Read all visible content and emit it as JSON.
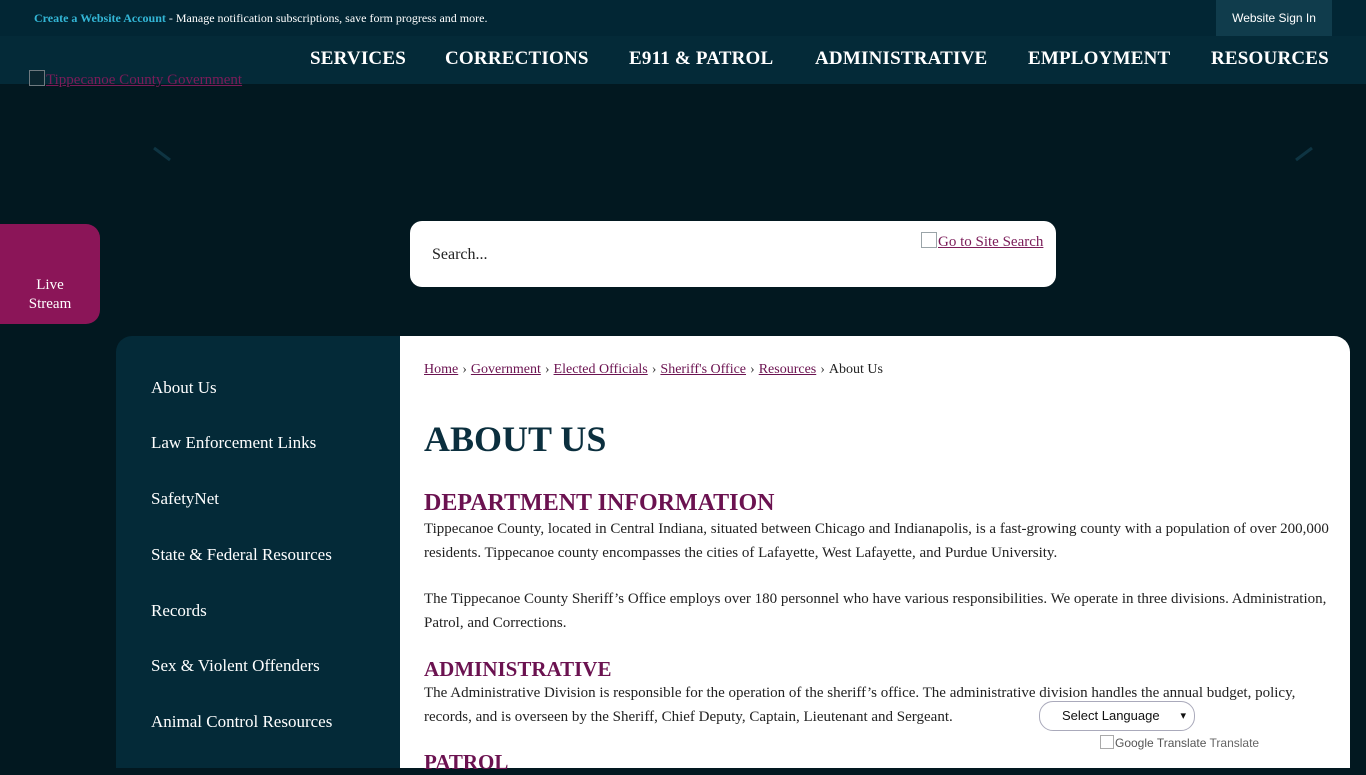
{
  "topbar": {
    "account_link": "Create a Website Account",
    "account_note": " - Manage notification subscriptions, save form progress and more.",
    "sign_in": "Website Sign In"
  },
  "nav": {
    "items": [
      "SERVICES",
      "CORRECTIONS",
      "E911 & PATROL",
      "ADMINISTRATIVE",
      "EMPLOYMENT",
      "RESOURCES"
    ]
  },
  "logo": {
    "alt": "Tippecanoe County Government"
  },
  "live_stream": {
    "label_line1": "Live",
    "label_line2": "Stream"
  },
  "search": {
    "placeholder": "Search...",
    "button_alt": "Go to Site Search"
  },
  "sidebar": {
    "items": [
      "About Us",
      "Law Enforcement Links",
      "SafetyNet",
      "State & Federal Resources",
      "Records",
      "Sex & Violent Offenders",
      "Animal Control Resources"
    ]
  },
  "breadcrumb": {
    "links": [
      "Home",
      "Government",
      "Elected Officials",
      "Sheriff's Office",
      "Resources"
    ],
    "current": "About Us"
  },
  "page": {
    "title": "ABOUT US",
    "sections": [
      {
        "heading": "DEPARTMENT INFORMATION",
        "paragraphs": [
          "Tippecanoe County, located in Central Indiana, situated between Chicago and Indianapolis, is a fast-growing county with a population of over 200,000 residents.  Tippecanoe county encompasses the cities of Lafayette, West Lafayette, and Purdue University.",
          "The Tippecanoe County Sheriff’s Office employs over 180 personnel who have various responsibilities.  We operate in three divisions.  Administration, Patrol, and Corrections."
        ]
      },
      {
        "heading": "ADMINISTRATIVE",
        "paragraphs": [
          "The Administrative Division is responsible for the operation of the sheriff’s office.  The administrative division handles the annual budget, policy, records, and is overseen by the Sheriff, Chief Deputy, Captain, Lieutenant and Sergeant."
        ]
      },
      {
        "heading": "PATROL",
        "paragraphs": []
      }
    ]
  },
  "translate": {
    "select_label": "Select Language",
    "logo_alt": "Google Translate",
    "label": "Translate"
  },
  "colors": {
    "accent_maroon": "#6b1250",
    "live_stream_bg": "#8b1558",
    "link_teal": "#33b6d6",
    "nav_bg": "#042a38",
    "page_bg": "#021820"
  }
}
